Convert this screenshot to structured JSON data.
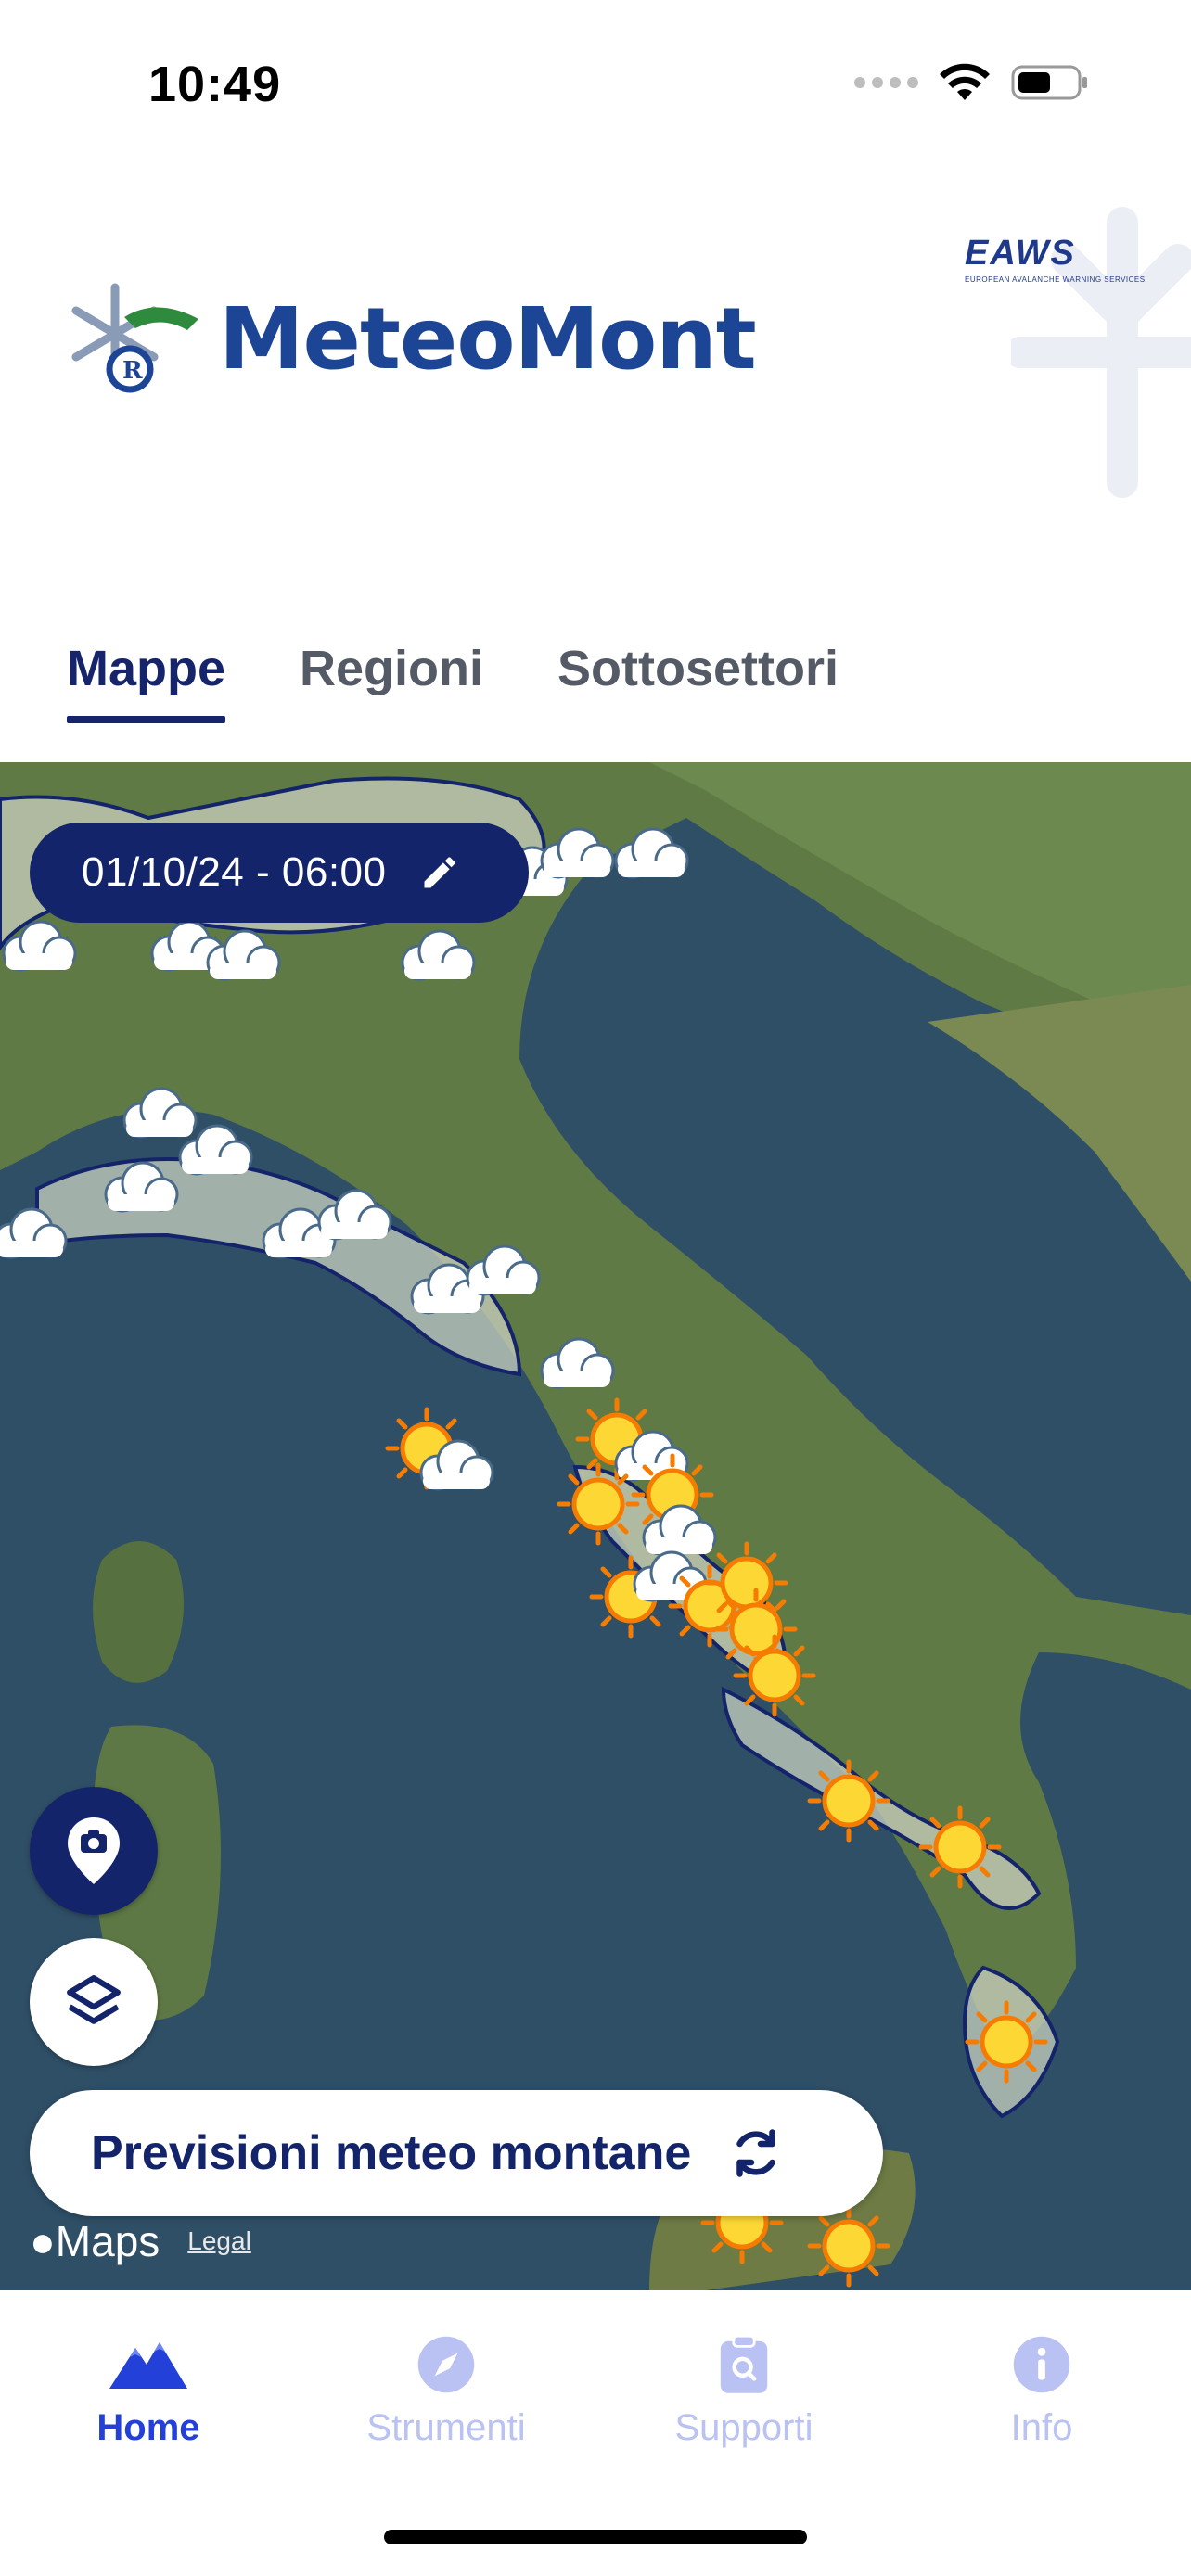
{
  "status_bar": {
    "time": "10:49"
  },
  "header": {
    "app_name": "MeteoMont",
    "partner_logo": {
      "title": "EAWS",
      "subtitle": "EUROPEAN AVALANCHE WARNING SERVICES"
    }
  },
  "tabs": [
    {
      "label": "Mappe",
      "active": true
    },
    {
      "label": "Regioni",
      "active": false
    },
    {
      "label": "Sottosettori",
      "active": false
    }
  ],
  "map": {
    "date_selector": {
      "value": "01/10/24 - 06:00",
      "icon": "pencil-icon"
    },
    "location_button_icon": "map-pin-camera-icon",
    "layers_button_icon": "layers-icon",
    "forecast_button": {
      "label": "Previsioni meteo montane",
      "icon": "refresh-icon"
    },
    "attribution": {
      "provider": "Maps",
      "legal": "Legal"
    },
    "weather_symbols": [
      "cloud-icon",
      "sun-icon",
      "sun-cloud-icon"
    ]
  },
  "bottom_nav": [
    {
      "label": "Home",
      "icon": "mountain-icon",
      "active": true
    },
    {
      "label": "Strumenti",
      "icon": "compass-icon",
      "active": false
    },
    {
      "label": "Supporti",
      "icon": "clipboard-search-icon",
      "active": false
    },
    {
      "label": "Info",
      "icon": "info-icon",
      "active": false
    }
  ],
  "colors": {
    "primary": "#13246a",
    "nav_active": "#2340d8",
    "nav_inactive": "#b9c2f2",
    "sun": "#fbc02d",
    "cloud": "#ffffff"
  }
}
